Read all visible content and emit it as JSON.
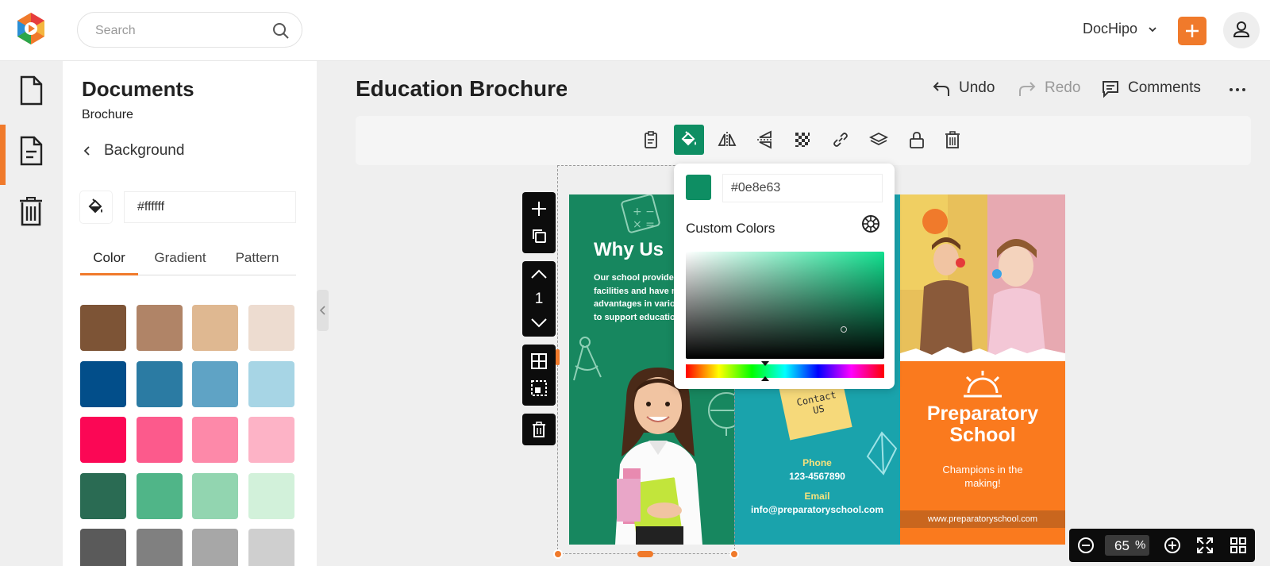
{
  "header": {
    "search_placeholder": "Search",
    "brand": "DocHipo"
  },
  "panel": {
    "title": "Documents",
    "subtitle": "Brochure",
    "back_label": "Background",
    "hex_value": "#ffffff",
    "tabs": [
      {
        "label": "Color",
        "active": true
      },
      {
        "label": "Gradient",
        "active": false
      },
      {
        "label": "Pattern",
        "active": false
      }
    ],
    "swatches": [
      [
        "#7d5436",
        "#b08467",
        "#dfb891",
        "#eddcd0"
      ],
      [
        "#024e8a",
        "#2b7ba3",
        "#5fa3c5",
        "#a7d5e5"
      ],
      [
        "#fb0755",
        "#fc5a8c",
        "#fd89a9",
        "#fdb3c6"
      ],
      [
        "#2a6b53",
        "#50b588",
        "#92d5b0",
        "#d2f1da"
      ],
      [
        "#5a5a5a",
        "#808080",
        "#a7a7a7",
        "#cfcfcf"
      ]
    ]
  },
  "workspace": {
    "doc_title": "Education Brochure",
    "undo_label": "Undo",
    "redo_label": "Redo",
    "comments_label": "Comments"
  },
  "toolbar": {
    "active_color": "#0e8e63",
    "tools": [
      "clipboard-icon",
      "paint-bucket-icon",
      "flip-horizontal-icon",
      "flip-vertical-icon",
      "transparency-icon",
      "link-icon",
      "layers-icon",
      "lock-icon",
      "trash-icon"
    ]
  },
  "page_tools": {
    "page_number": "1"
  },
  "brochure": {
    "col1_heading": "Why Us",
    "col1_body": "Our school provides good facilities and have many advantages in various fields to support education.",
    "sticky_text": "Contact US",
    "phone_label": "Phone",
    "phone_value": "123-4567890",
    "email_label": "Email",
    "email_value": "info@preparatoryschool.com",
    "school_name": "Preparatory School",
    "tagline": "Champions in the making!",
    "website": "www.preparatoryschool.com"
  },
  "color_picker": {
    "hex_value": "#0e8e63",
    "custom_colors_label": "Custom Colors",
    "swatch_color": "#0e8e63",
    "hue_level_percent": 40
  },
  "zoom": {
    "value": "65",
    "unit": "%"
  }
}
